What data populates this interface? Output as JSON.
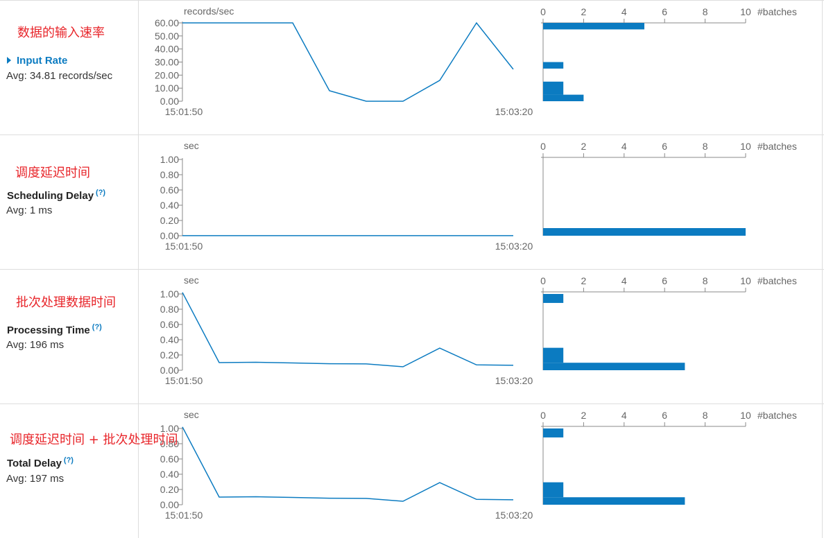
{
  "rows": [
    {
      "annotation": "数据的输入速率",
      "metric": "Input Rate",
      "avg": "Avg: 34.81 records/sec",
      "has_help": false
    },
    {
      "annotation": "调度延迟时间",
      "metric": "Scheduling Delay",
      "avg": "Avg: 1 ms",
      "has_help": true
    },
    {
      "annotation": "批次处理数据时间",
      "metric": "Processing Time",
      "avg": "Avg: 196 ms",
      "has_help": true
    },
    {
      "annotation": "调度延迟时间 + 批次处理时间",
      "metric": "Total Delay",
      "avg": "Avg: 197 ms",
      "has_help": true
    }
  ],
  "help_glyph": "(?)",
  "chart_data": [
    {
      "type": "line",
      "ylabel": "records/sec",
      "yticks": [
        "60.00",
        "50.00",
        "40.00",
        "30.00",
        "20.00",
        "10.00",
        "0.00"
      ],
      "ylim": [
        0,
        60
      ],
      "x_tick_labels": [
        "15:01:50",
        "15:03:20"
      ],
      "x": [
        "15:01:50",
        "15:02:00",
        "15:02:10",
        "15:02:20",
        "15:02:30",
        "15:02:40",
        "15:02:50",
        "15:03:00",
        "15:03:10",
        "15:03:20"
      ],
      "values": [
        60,
        60,
        60,
        60,
        8,
        0,
        0,
        16,
        60,
        24.5
      ],
      "color": "#0b7bc1"
    },
    {
      "type": "line",
      "ylabel": "sec",
      "yticks": [
        "1.00",
        "0.80",
        "0.60",
        "0.40",
        "0.20",
        "0.00"
      ],
      "ylim": [
        0,
        1
      ],
      "x_tick_labels": [
        "15:01:50",
        "15:03:20"
      ],
      "x": [
        "15:01:50",
        "15:02:00",
        "15:02:10",
        "15:02:20",
        "15:02:30",
        "15:02:40",
        "15:02:50",
        "15:03:00",
        "15:03:10",
        "15:03:20"
      ],
      "values": [
        0.001,
        0.001,
        0.001,
        0.001,
        0.001,
        0.001,
        0.001,
        0.001,
        0.001,
        0.001
      ],
      "color": "#0b7bc1"
    },
    {
      "type": "line",
      "ylabel": "sec",
      "yticks": [
        "1.00",
        "0.80",
        "0.60",
        "0.40",
        "0.20",
        "0.00"
      ],
      "ylim": [
        0,
        1
      ],
      "x_tick_labels": [
        "15:01:50",
        "15:03:20"
      ],
      "x": [
        "15:01:50",
        "15:02:00",
        "15:02:10",
        "15:02:20",
        "15:02:30",
        "15:02:40",
        "15:02:50",
        "15:03:00",
        "15:03:10",
        "15:03:20"
      ],
      "values": [
        1.02,
        0.1,
        0.105,
        0.095,
        0.085,
        0.083,
        0.045,
        0.29,
        0.07,
        0.065
      ],
      "color": "#0b7bc1"
    },
    {
      "type": "line",
      "ylabel": "sec",
      "yticks": [
        "1.00",
        "0.80",
        "0.60",
        "0.40",
        "0.20",
        "0.00"
      ],
      "ylim": [
        0,
        1
      ],
      "x_tick_labels": [
        "15:01:50",
        "15:03:20"
      ],
      "x": [
        "15:01:50",
        "15:02:00",
        "15:02:10",
        "15:02:20",
        "15:02:30",
        "15:02:40",
        "15:02:50",
        "15:03:00",
        "15:03:10",
        "15:03:20"
      ],
      "values": [
        1.02,
        0.1,
        0.105,
        0.095,
        0.085,
        0.083,
        0.045,
        0.29,
        0.07,
        0.065
      ],
      "color": "#0b7bc1"
    }
  ],
  "histograms": [
    {
      "type": "bar",
      "xlabel": "#batches",
      "xticks": [
        "0",
        "2",
        "4",
        "6",
        "8",
        "10"
      ],
      "xlim": [
        0,
        10
      ],
      "ylim": [
        0,
        60
      ],
      "bins": [
        {
          "from": 55,
          "to": 60,
          "count": 5
        },
        {
          "from": 25,
          "to": 30,
          "count": 1
        },
        {
          "from": 5,
          "to": 15,
          "count": 1
        },
        {
          "from": 0,
          "to": 5,
          "count": 2
        }
      ],
      "color": "#0b7bc1"
    },
    {
      "type": "bar",
      "xlabel": "#batches",
      "xticks": [
        "0",
        "2",
        "4",
        "6",
        "8",
        "10"
      ],
      "xlim": [
        0,
        10
      ],
      "ylim": [
        0,
        1
      ],
      "bins": [
        {
          "from": 0,
          "to": 0.1,
          "count": 10
        }
      ],
      "color": "#0b7bc1"
    },
    {
      "type": "bar",
      "xlabel": "#batches",
      "xticks": [
        "0",
        "2",
        "4",
        "6",
        "8",
        "10"
      ],
      "xlim": [
        0,
        10
      ],
      "ylim": [
        0,
        1.02
      ],
      "bins": [
        {
          "from": 0.9,
          "to": 1.02,
          "count": 1
        },
        {
          "from": 0.1,
          "to": 0.3,
          "count": 1
        },
        {
          "from": 0,
          "to": 0.1,
          "count": 7
        }
      ],
      "color": "#0b7bc1"
    },
    {
      "type": "bar",
      "xlabel": "#batches",
      "xticks": [
        "0",
        "2",
        "4",
        "6",
        "8",
        "10"
      ],
      "xlim": [
        0,
        10
      ],
      "ylim": [
        0,
        1.02
      ],
      "bins": [
        {
          "from": 0.9,
          "to": 1.02,
          "count": 1
        },
        {
          "from": 0.1,
          "to": 0.3,
          "count": 1
        },
        {
          "from": 0,
          "to": 0.1,
          "count": 7
        }
      ],
      "color": "#0b7bc1"
    }
  ]
}
